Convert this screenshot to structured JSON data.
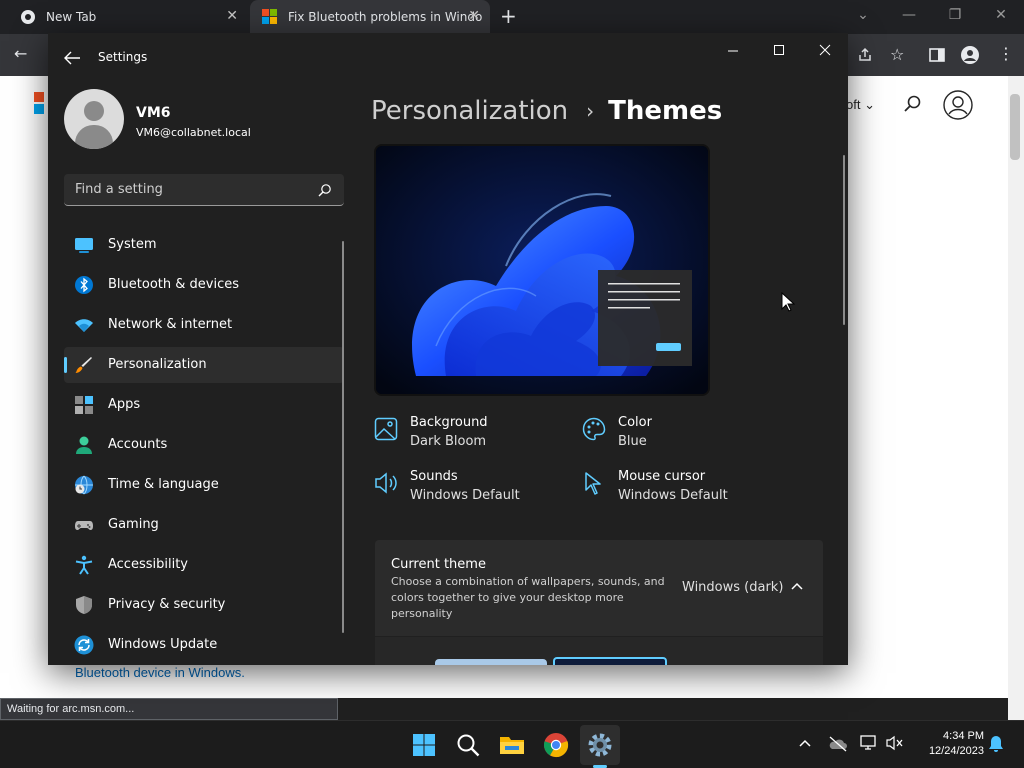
{
  "browser": {
    "tabs": [
      {
        "title": "New Tab"
      },
      {
        "title": "Fix Bluetooth problems in Windo"
      }
    ],
    "page": {
      "nav_label": "oft",
      "link_text": "Bluetooth device in Windows.",
      "status_text": "Waiting for arc.msn.com..."
    }
  },
  "settings": {
    "window_title": "Settings",
    "profile": {
      "name": "VM6",
      "email": "VM6@collabnet.local"
    },
    "search": {
      "placeholder": "Find a setting"
    },
    "nav": [
      {
        "label": "System",
        "icon": "system-icon"
      },
      {
        "label": "Bluetooth & devices",
        "icon": "bluetooth-icon"
      },
      {
        "label": "Network & internet",
        "icon": "wifi-icon"
      },
      {
        "label": "Personalization",
        "icon": "paintbrush-icon",
        "active": true
      },
      {
        "label": "Apps",
        "icon": "apps-icon"
      },
      {
        "label": "Accounts",
        "icon": "person-icon"
      },
      {
        "label": "Time & language",
        "icon": "globe-clock-icon"
      },
      {
        "label": "Gaming",
        "icon": "gamepad-icon"
      },
      {
        "label": "Accessibility",
        "icon": "accessibility-icon"
      },
      {
        "label": "Privacy & security",
        "icon": "shield-icon"
      },
      {
        "label": "Windows Update",
        "icon": "update-icon"
      }
    ],
    "breadcrumb": {
      "parent": "Personalization",
      "separator": "›",
      "current": "Themes"
    },
    "properties": {
      "background": {
        "label": "Background",
        "value": "Dark Bloom"
      },
      "color": {
        "label": "Color",
        "value": "Blue"
      },
      "sounds": {
        "label": "Sounds",
        "value": "Windows Default"
      },
      "mouse_cursor": {
        "label": "Mouse cursor",
        "value": "Windows Default"
      }
    },
    "current_theme": {
      "title": "Current theme",
      "description": "Choose a combination of wallpapers, sounds, and colors together to give your desktop more personality",
      "value": "Windows (dark)"
    },
    "accent_color": "#60cdff"
  },
  "taskbar": {
    "clock_time": "4:34 PM",
    "clock_date": "12/24/2023"
  }
}
